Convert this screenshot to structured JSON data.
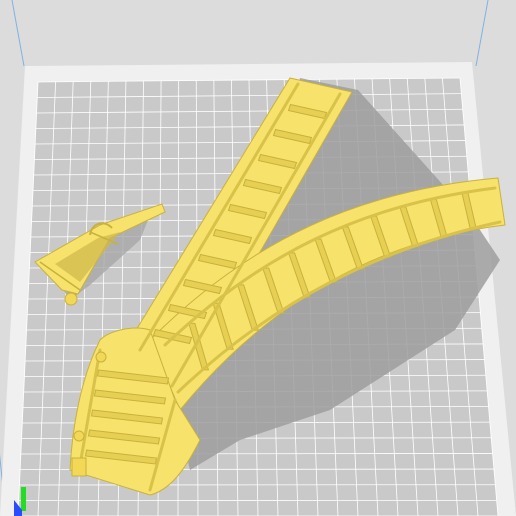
{
  "viewer": {
    "background_color": "#dcdcdc",
    "plate_color": "#c8c8c8",
    "plate_border_color": "#f0f0f0",
    "grid_color": "#ffffff",
    "volume_edge_color": "#7fb3e0",
    "model_color": "#f7e26b",
    "model_edge_color": "#c8b23c",
    "shadow_color": "#9a9a9a"
  },
  "objects": [
    {
      "name": "track-switch-model",
      "selected": false
    },
    {
      "name": "small-part-model",
      "selected": false
    }
  ],
  "axes": {
    "x_axis_color": "#2b4bff",
    "y_axis_color": "#22dd22",
    "icons": [
      "axis-y-icon",
      "axis-x-icon"
    ]
  }
}
